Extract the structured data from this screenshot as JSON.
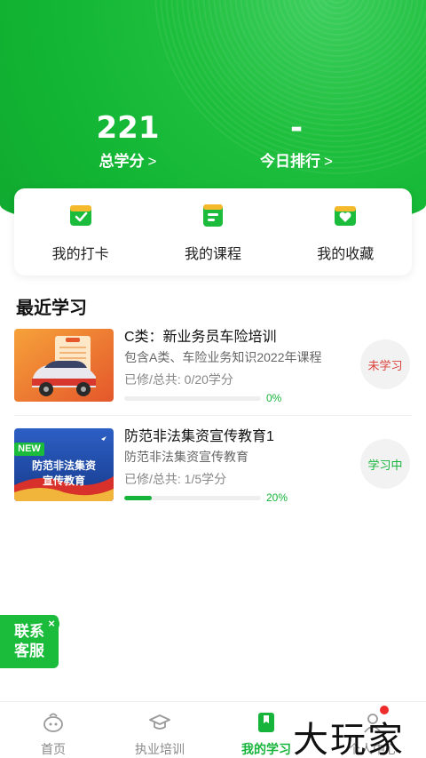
{
  "stats": {
    "total_credits_value": "221",
    "total_credits_label": "总学分",
    "rank_value": "-",
    "rank_label": "今日排行",
    "chevron": ">"
  },
  "quick_actions": [
    {
      "label": "我的打卡",
      "icon": "checkin-icon"
    },
    {
      "label": "我的课程",
      "icon": "course-icon"
    },
    {
      "label": "我的收藏",
      "icon": "favorite-icon"
    }
  ],
  "recent": {
    "title": "最近学习",
    "courses": [
      {
        "title": "C类：新业务员车险培训",
        "subtitle": "包含A类、车险业务知识2022年课程",
        "progress_text": "已修/总共: 0/20学分",
        "progress_fraction": 0,
        "percent_label": "0%",
        "status": "未学习",
        "status_color": "#d9403a"
      },
      {
        "title": "防范非法集资宣传教育1",
        "subtitle": "防范非法集资宣传教育",
        "progress_text": "已修/总共: 1/5学分",
        "progress_fraction": 0.2,
        "percent_label": "20%",
        "status": "学习中",
        "status_color": "#16b43a",
        "thumb_badge": "NEW",
        "thumb_line1": "防范非法集资",
        "thumb_line2": "宣传教育"
      }
    ]
  },
  "customer_service": {
    "line1": "联系",
    "line2": "客服",
    "close": "×"
  },
  "tabbar": [
    {
      "label": "首页",
      "icon": "home-icon",
      "active": false
    },
    {
      "label": "执业培训",
      "icon": "graduation-cap-icon",
      "active": false
    },
    {
      "label": "我的学习",
      "icon": "bookmark-book-icon",
      "active": true
    },
    {
      "label": "个人中心",
      "icon": "person-icon",
      "active": false
    }
  ],
  "watermark": "大玩家",
  "colors": {
    "primary": "#16b43a",
    "hero": "#12b534",
    "alert": "#d9403a"
  }
}
